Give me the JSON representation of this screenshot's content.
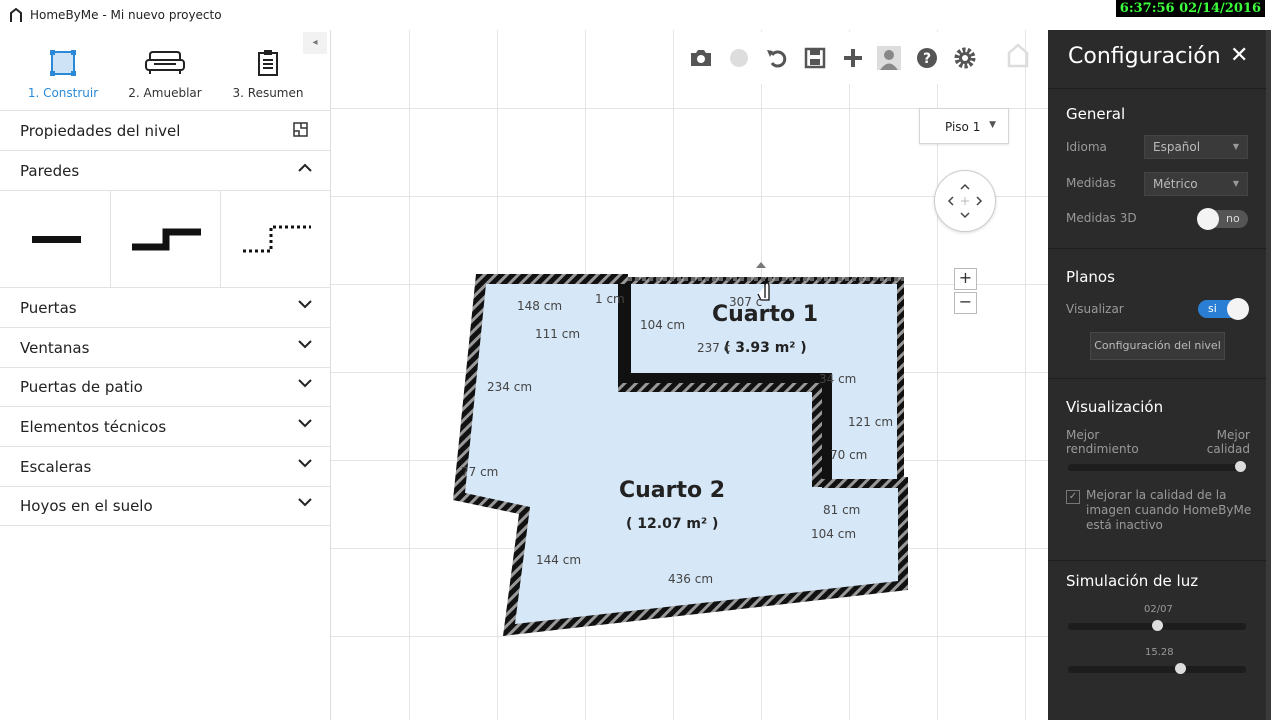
{
  "app": {
    "title": "HomeByMe - Mi nuevo proyecto"
  },
  "clock": "6:37:56  02/14/2016",
  "steps": [
    {
      "label": "1. Construir",
      "icon": "floor-plan-icon"
    },
    {
      "label": "2. Amueblar",
      "icon": "sofa-icon"
    },
    {
      "label": "3. Resumen",
      "icon": "clipboard-icon"
    }
  ],
  "left": {
    "level_properties": "Propiedades del nivel",
    "walls_header": "Paredes",
    "categories": [
      "Puertas",
      "Ventanas",
      "Puertas de patio",
      "Elementos técnicos",
      "Escaleras",
      "Hoyos en el suelo"
    ]
  },
  "floor_select": {
    "value": "Piso 1"
  },
  "plan": {
    "room1": {
      "name": "Cuarto 1",
      "area": "( 3.93 m² )"
    },
    "room2": {
      "name": "Cuarto 2",
      "area": "( 12.07 m² )"
    },
    "dims": [
      "148 cm",
      "1 cm",
      "307 c",
      "104 cm",
      "111 cm",
      "237 c",
      "34 cm",
      "234 cm",
      "121 cm",
      "70 cm",
      "77 cm",
      "81 cm",
      "104 cm",
      "144 cm",
      "436 cm"
    ]
  },
  "settings": {
    "title": "Configuración",
    "general": {
      "title": "General",
      "language_label": "Idioma",
      "language_value": "Español",
      "units_label": "Medidas",
      "units_value": "Métrico",
      "dims3d_label": "Medidas 3D",
      "dims3d_value": "no"
    },
    "plans": {
      "title": "Planos",
      "show_label": "Visualizar",
      "show_value": "si",
      "level_button": "Configuración del nivel"
    },
    "display": {
      "title": "Visualización",
      "left_label": "Mejor rendimiento",
      "right_label": "Mejor calidad",
      "quality": 1.0,
      "checkbox_label": "Mejorar la calidad de la imagen cuando HomeByMe está inactivo"
    },
    "light": {
      "title": "Simulación de luz",
      "date_label": "02/07",
      "date_pos": 0.5,
      "time_label": "15.28",
      "time_pos": 0.64
    }
  }
}
